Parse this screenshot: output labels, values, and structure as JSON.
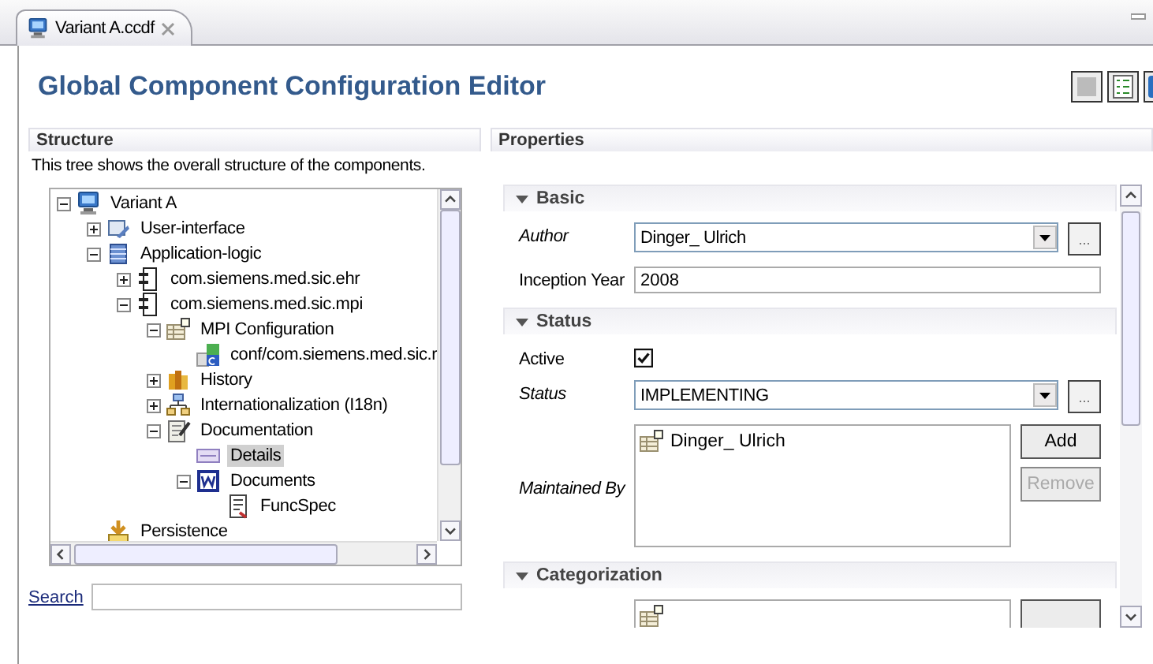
{
  "tab": {
    "title": "Variant A.ccdf"
  },
  "editor": {
    "title": "Global Component Configuration Editor"
  },
  "structure": {
    "heading": "Structure",
    "description": "This tree shows the overall structure of the components.",
    "tree": [
      {
        "label": "Variant A",
        "kind": "computer",
        "expanded": true,
        "selected": false,
        "children": [
          {
            "label": "User-interface",
            "kind": "ui",
            "expanded": false,
            "selected": false
          },
          {
            "label": "Application-logic",
            "kind": "database",
            "expanded": true,
            "selected": false,
            "children": [
              {
                "label": "com.siemens.med.sic.ehr",
                "kind": "component",
                "expanded": false,
                "selected": false
              },
              {
                "label": "com.siemens.med.sic.mpi",
                "kind": "component",
                "expanded": true,
                "selected": false,
                "children": [
                  {
                    "label": "MPI Configuration",
                    "kind": "config",
                    "expanded": true,
                    "selected": false,
                    "children": [
                      {
                        "label": "conf/com.siemens.med.sic.r",
                        "kind": "file",
                        "selected": false
                      }
                    ]
                  },
                  {
                    "label": "History",
                    "kind": "history",
                    "expanded": false,
                    "selected": false
                  },
                  {
                    "label": "Internationalization (I18n)",
                    "kind": "network",
                    "expanded": false,
                    "selected": false
                  },
                  {
                    "label": "Documentation",
                    "kind": "documentation",
                    "expanded": true,
                    "selected": false,
                    "children": [
                      {
                        "label": "Details",
                        "kind": "details",
                        "selected": true
                      },
                      {
                        "label": "Documents",
                        "kind": "word",
                        "expanded": true,
                        "selected": false,
                        "children": [
                          {
                            "label": "FuncSpec",
                            "kind": "spec",
                            "selected": false
                          }
                        ]
                      }
                    ]
                  }
                ]
              }
            ]
          },
          {
            "label": "Persistence",
            "kind": "persistence",
            "selected": false
          }
        ]
      }
    ],
    "search": {
      "label": "Search"
    }
  },
  "properties": {
    "heading": "Properties",
    "sections": [
      {
        "title": "Basic",
        "expanded": true,
        "fields": [
          {
            "kind": "combo",
            "label": "Author",
            "emphasized": true,
            "value": "Dinger_ Ulrich",
            "button": "..."
          },
          {
            "kind": "text",
            "label": "Inception Year",
            "emphasized": false,
            "value": "2008"
          }
        ]
      },
      {
        "title": "Status",
        "expanded": true,
        "fields": [
          {
            "kind": "checkbox",
            "label": "Active",
            "emphasized": false,
            "checked": true
          },
          {
            "kind": "combo",
            "label": "Status",
            "emphasized": true,
            "value": "IMPLEMENTING",
            "button": "..."
          },
          {
            "kind": "list",
            "label": "Maintained By",
            "emphasized": true,
            "items": [
              "Dinger_ Ulrich"
            ],
            "buttons": [
              {
                "label": "Add",
                "disabled": false
              },
              {
                "label": "Remove",
                "disabled": true
              }
            ]
          }
        ]
      },
      {
        "title": "Categorization",
        "expanded": true,
        "fields": [
          {
            "kind": "list",
            "emphasized": false,
            "buttons": [
              {
                "disabled": false
              }
            ]
          }
        ]
      }
    ]
  }
}
